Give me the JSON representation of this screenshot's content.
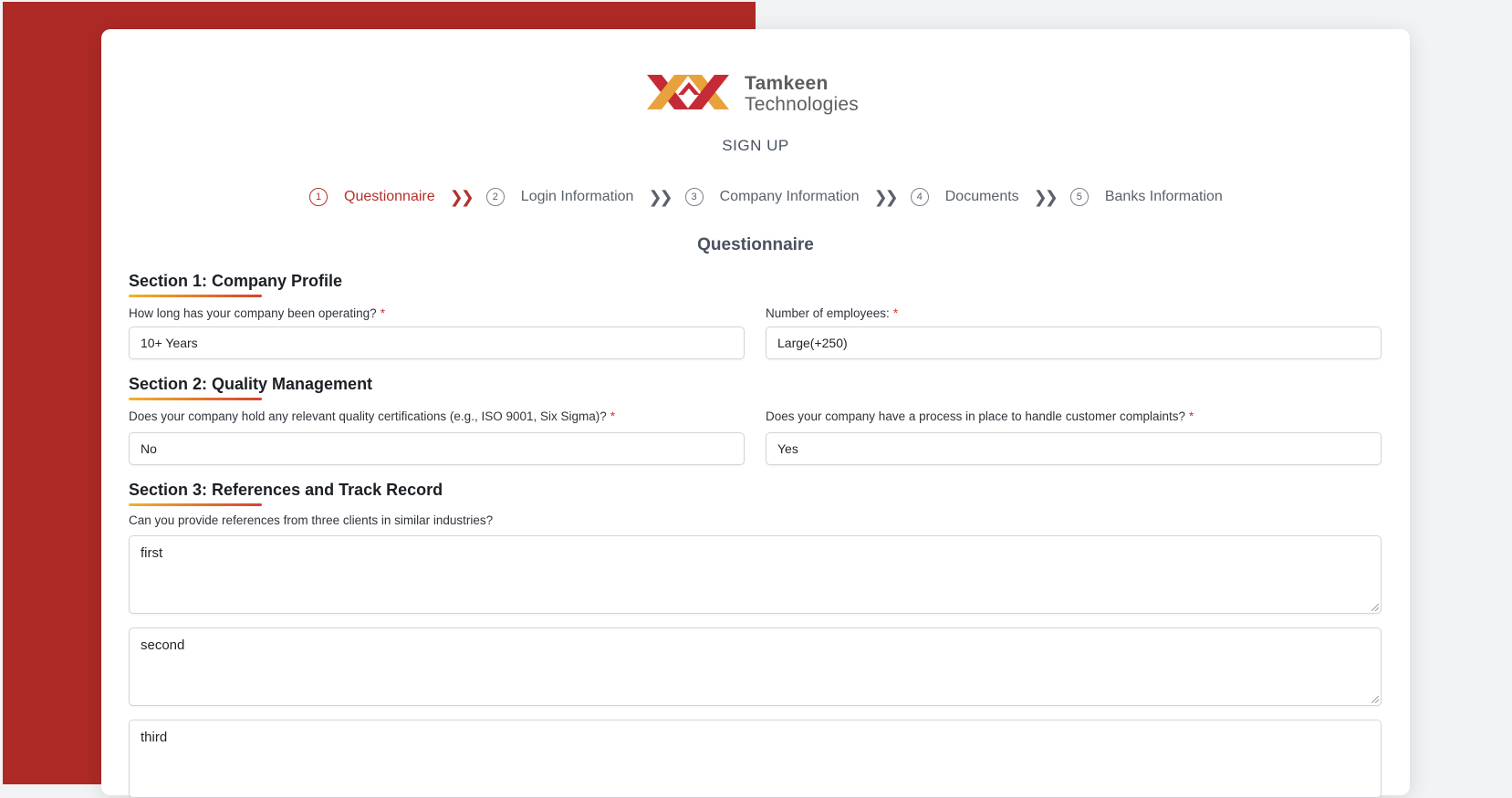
{
  "brand": {
    "line1": "Tamkeen",
    "line2": "Technologies",
    "logo_icon": "tamkeen-logo-icon"
  },
  "header": {
    "title": "SIGN UP"
  },
  "steps": [
    {
      "num": "1",
      "label": "Questionnaire"
    },
    {
      "num": "2",
      "label": "Login Information"
    },
    {
      "num": "3",
      "label": "Company Information"
    },
    {
      "num": "4",
      "label": "Documents"
    },
    {
      "num": "5",
      "label": "Banks Information"
    }
  ],
  "form": {
    "title": "Questionnaire"
  },
  "section1": {
    "title": "Section 1: Company Profile",
    "q1_label": "How long has your company been operating?",
    "q1_value": "10+ Years",
    "q2_label": "Number of employees:",
    "q2_value": "Large(+250)"
  },
  "section2": {
    "title": "Section 2: Quality Management",
    "q1_label": "Does your company hold any relevant quality certifications (e.g., ISO 9001, Six Sigma)?",
    "q1_value": "No",
    "q2_label": "Does your company have a process in place to handle customer complaints?",
    "q2_value": "Yes"
  },
  "section3": {
    "title": "Section 3: References and Track Record",
    "q_label": "Can you provide references from three clients in similar industries?",
    "ref1": "first",
    "ref2": "second",
    "ref3": "third"
  },
  "required_mark": "*",
  "colors": {
    "accent": "#b3312b",
    "background_left": "#ae2a26",
    "underline_start": "#f0b429",
    "underline_end": "#d7412f"
  }
}
